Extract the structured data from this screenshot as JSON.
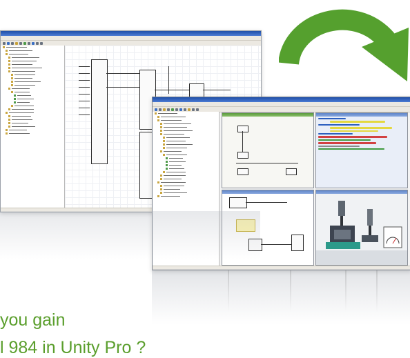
{
  "headline": {
    "line1": "you gain",
    "line2": "l 984 in Unity Pro ?"
  },
  "back_window": {
    "title": "",
    "menu": ""
  },
  "front_window": {
    "title": "",
    "menu": ""
  },
  "colors": {
    "arrow_green": "#55a02e",
    "headline_green": "#5a9e2c",
    "titlebar_blue": "#1f4fa8"
  },
  "icons": {
    "arrow": "curved-arrow-icon"
  }
}
